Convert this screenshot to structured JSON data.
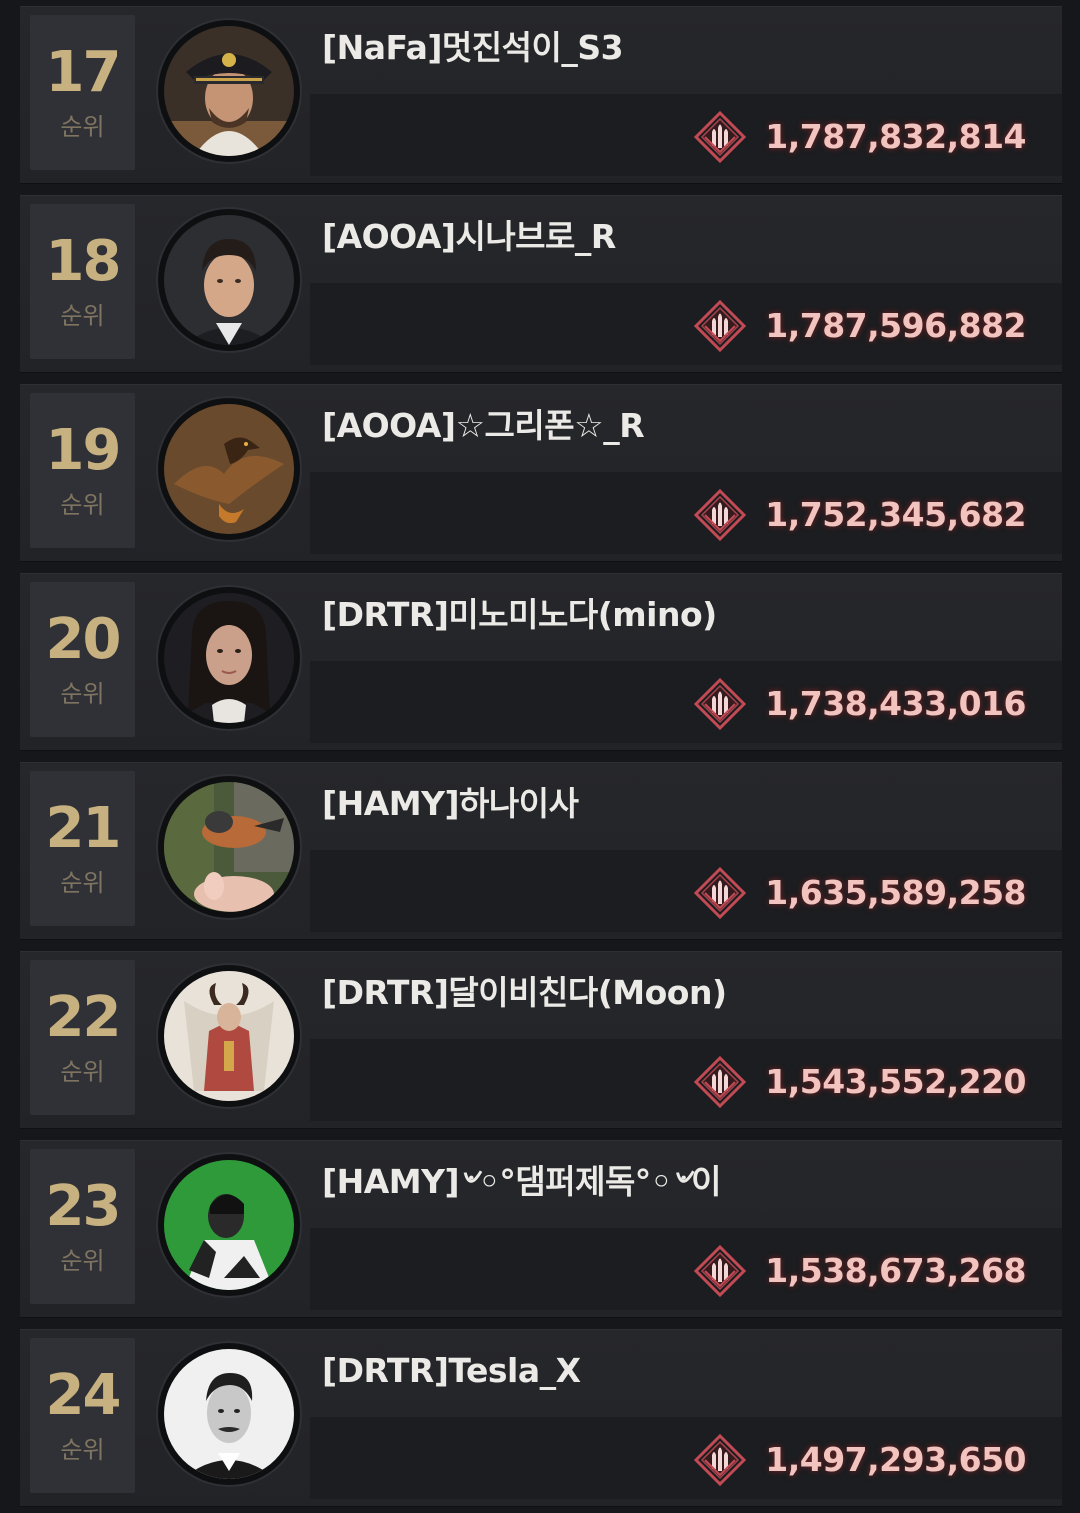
{
  "rank_unit": "순위",
  "colors": {
    "rank_number": "#c8b180",
    "rank_unit": "#7e7461",
    "score": "#f2c4c0",
    "ammo_icon": "#c24a55"
  },
  "entries": [
    {
      "rank": "17",
      "name": "[NaFa]멋진석이_S3",
      "score": "1,787,832,814",
      "avatar_icon": "naval-officer-avatar-icon"
    },
    {
      "rank": "18",
      "name": "[AOOA]시나브로_R",
      "score": "1,787,596,882",
      "avatar_icon": "man-in-suit-avatar-icon"
    },
    {
      "rank": "19",
      "name": "[AOOA]☆그리폰☆_R",
      "score": "1,752,345,682",
      "avatar_icon": "eagle-avatar-icon"
    },
    {
      "rank": "20",
      "name": "[DRTR]미노미노다(mino)",
      "score": "1,738,433,016",
      "avatar_icon": "woman-portrait-avatar-icon"
    },
    {
      "rank": "21",
      "name": "[HAMY]하나이사",
      "score": "1,635,589,258",
      "avatar_icon": "bird-on-hand-avatar-icon"
    },
    {
      "rank": "22",
      "name": "[DRTR]달이비친다(Moon)",
      "score": "1,543,552,220",
      "avatar_icon": "horned-figure-avatar-icon"
    },
    {
      "rank": "23",
      "name": "[HAMY]৺◦°댐퍼제독°◦৺이",
      "score": "1,538,673,268",
      "avatar_icon": "man-on-green-avatar-icon"
    },
    {
      "rank": "24",
      "name": "[DRTR]Tesla_X",
      "score": "1,497,293,650",
      "avatar_icon": "bw-portrait-avatar-icon"
    }
  ]
}
